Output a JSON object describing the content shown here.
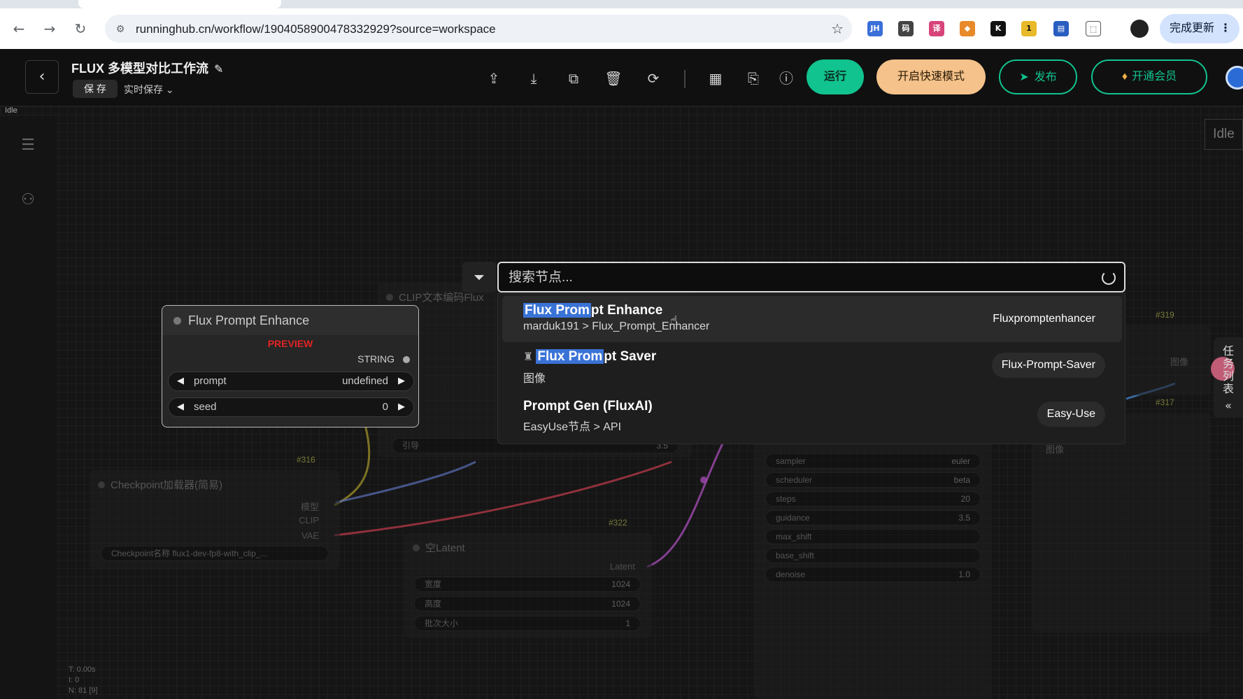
{
  "browser": {
    "url": "runninghub.cn/workflow/1904058900478332929?source=workspace",
    "update_button": "完成更新",
    "extensions": [
      "JH",
      "码",
      "译",
      "◆",
      "K",
      "1",
      "▤",
      "⬚"
    ]
  },
  "app": {
    "workflow_title": "FLUX 多模型对比工作流",
    "save_label": "保 存",
    "autosave_label": "实时保存",
    "run_label": "运行",
    "fast_mode_label": "开启快速模式",
    "publish_label": "发布",
    "vip_label": "开通会员",
    "status_idle": "Idle"
  },
  "search": {
    "placeholder": "搜索节点...",
    "results": [
      {
        "highlight": "Flux Prom",
        "rest": "pt Enhance",
        "sub": "marduk191 > Flux_Prompt_Enhancer",
        "tag": "Fluxpromptenhancer",
        "active": true
      },
      {
        "highlight": "Flux Prom",
        "rest": "pt Saver",
        "sub": "图像",
        "tag": "Flux-Prompt-Saver",
        "active": false
      },
      {
        "highlight": "",
        "rest": "Prompt Gen (FluxAI)",
        "sub": "EasyUse节点 > API",
        "tag": "Easy-Use",
        "active": false
      }
    ]
  },
  "preview_node": {
    "title": "Flux Prompt Enhance",
    "preview_label": "PREVIEW",
    "output_label": "STRING",
    "widgets": [
      {
        "key": "prompt",
        "value": "undefined"
      },
      {
        "key": "seed",
        "value": "0"
      }
    ]
  },
  "bg_nodes": {
    "clip_title": "CLIP文本编码Flux",
    "clip_guide_label": "引导",
    "clip_guide_value": "3.5",
    "checkpoint_id": "#316",
    "checkpoint_title": "Checkpoint加载器(简易)",
    "checkpoint_ports": [
      "模型",
      "CLIP",
      "VAE"
    ],
    "checkpoint_widget_label": "Checkpoint名称",
    "checkpoint_widget_value": "flux1-dev-fp8-with_clip_...",
    "latent_id": "#322",
    "latent_title": "空Latent",
    "latent_output": "Latent",
    "latent_widgets": [
      {
        "key": "宽度",
        "value": "1024"
      },
      {
        "key": "高度",
        "value": "1024"
      },
      {
        "key": "批次大小",
        "value": "1"
      }
    ],
    "sampler_widgets": [
      {
        "key": "sampler",
        "value": "euler"
      },
      {
        "key": "scheduler",
        "value": "beta"
      },
      {
        "key": "steps",
        "value": "20"
      },
      {
        "key": "guidance",
        "value": "3.5"
      },
      {
        "key": "max_shift",
        "value": ""
      },
      {
        "key": "base_shift",
        "value": ""
      },
      {
        "key": "denoise",
        "value": "1.0"
      }
    ],
    "right_id_1": "#319",
    "right_id_2": "#317",
    "right_port": "图像",
    "right_port_2": "图像"
  },
  "task_tab": {
    "label": "任务列表"
  },
  "stats": {
    "line1": "T: 0.00s",
    "line2": "I: 0",
    "line3": "N: 81 [9]"
  }
}
